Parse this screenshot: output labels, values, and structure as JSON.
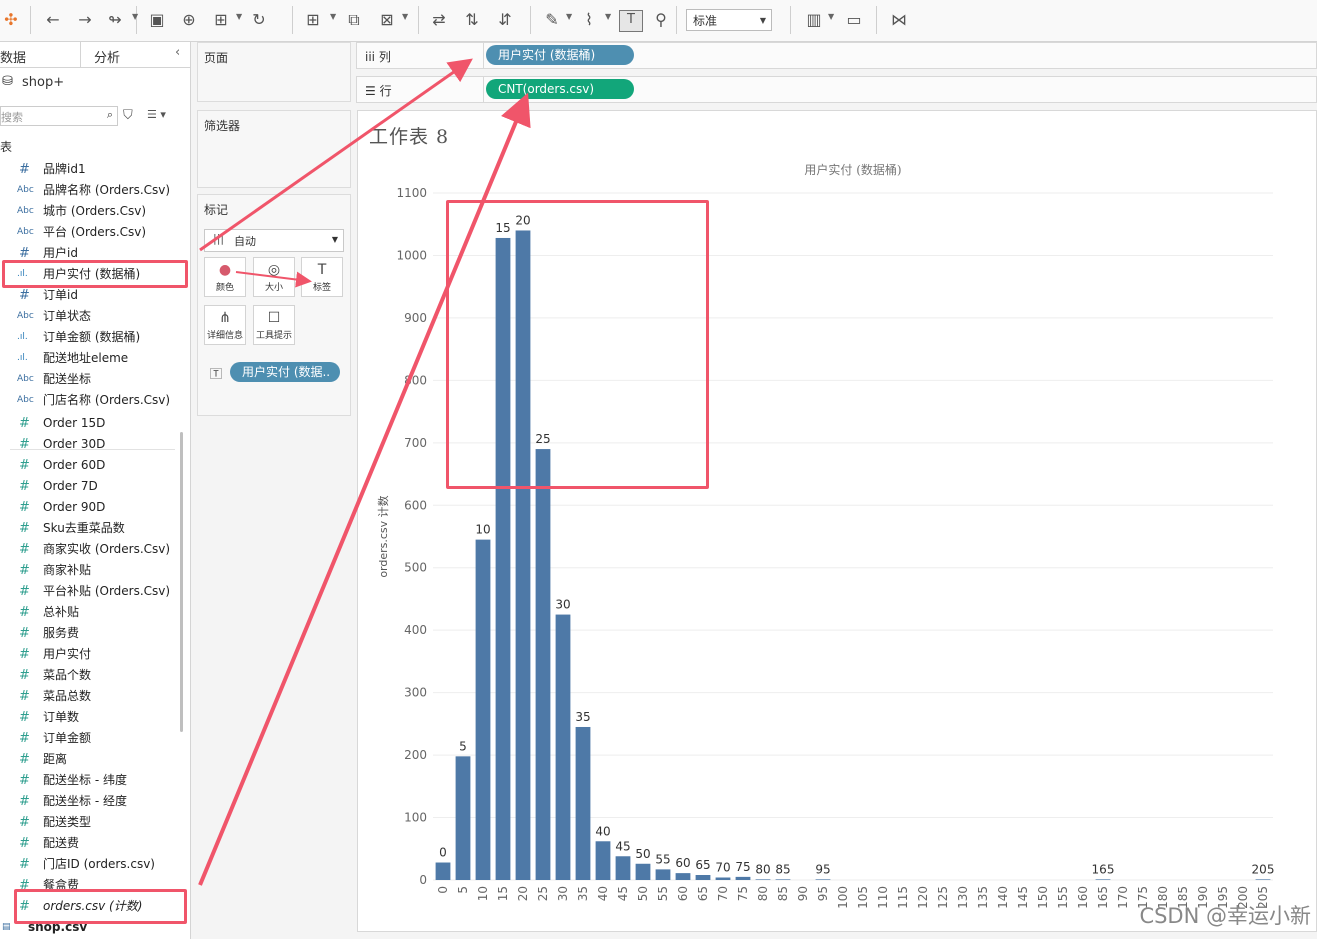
{
  "toolbar": {
    "icons": [
      "tableau-logo-icon",
      "undo-icon",
      "redo-icon",
      "replay-icon",
      "save-icon",
      "new-datasource-icon",
      "paste-datasource-icon",
      "refresh-icon",
      "new-sheet-icon",
      "duplicate-sheet-icon",
      "clear-sheet-icon",
      "swap-axes-icon",
      "sort-asc-icon",
      "sort-desc-icon",
      "highlight-icon",
      "group-icon",
      "show-labels-icon",
      "pin-icon",
      "show-me-icon",
      "presentation-icon",
      "share-icon"
    ],
    "view_size": "标准"
  },
  "data_pane": {
    "tab_data": "数据",
    "tab_analysis": "分析",
    "datasource": "shop+",
    "search_placeholder": "搜索",
    "table_header": "表",
    "fields": [
      {
        "type": "hash",
        "label": "品牌id1"
      },
      {
        "type": "abc",
        "label": "品牌名称 (Orders.Csv)"
      },
      {
        "type": "abc",
        "label": "城市 (Orders.Csv)"
      },
      {
        "type": "abc",
        "label": "平台 (Orders.Csv)"
      },
      {
        "type": "hash",
        "label": "用户id"
      },
      {
        "type": "bin",
        "label": "用户实付 (数据桶)"
      },
      {
        "type": "hash",
        "label": "订单id"
      },
      {
        "type": "abc",
        "label": "订单状态"
      },
      {
        "type": "bin",
        "label": "订单金额 (数据桶)"
      },
      {
        "type": "bin",
        "label": "配送地址eleme"
      },
      {
        "type": "abc",
        "label": "配送坐标"
      },
      {
        "type": "abc",
        "label": "门店名称 (Orders.Csv)"
      },
      {
        "type": "measure",
        "label": "Order 15D"
      },
      {
        "type": "measure",
        "label": "Order 30D"
      },
      {
        "type": "measure",
        "label": "Order 60D"
      },
      {
        "type": "measure",
        "label": "Order 7D"
      },
      {
        "type": "measure",
        "label": "Order 90D"
      },
      {
        "type": "measure",
        "label": "Sku去重菜品数"
      },
      {
        "type": "measure",
        "label": "商家实收 (Orders.Csv)"
      },
      {
        "type": "measure",
        "label": "商家补贴"
      },
      {
        "type": "measure",
        "label": "平台补贴 (Orders.Csv)"
      },
      {
        "type": "measure",
        "label": "总补贴"
      },
      {
        "type": "measure",
        "label": "服务费"
      },
      {
        "type": "measure",
        "label": "用户实付"
      },
      {
        "type": "measure",
        "label": "菜品个数"
      },
      {
        "type": "measure",
        "label": "菜品总数"
      },
      {
        "type": "measure",
        "label": "订单数"
      },
      {
        "type": "measure",
        "label": "订单金额"
      },
      {
        "type": "measure",
        "label": "距离"
      },
      {
        "type": "measure",
        "label": "配送坐标 - 纬度"
      },
      {
        "type": "measure",
        "label": "配送坐标 - 经度"
      },
      {
        "type": "measure",
        "label": "配送类型"
      },
      {
        "type": "measure",
        "label": "配送费"
      },
      {
        "type": "measure",
        "label": "门店ID (orders.csv)"
      },
      {
        "type": "measure",
        "label": "餐盒费"
      },
      {
        "type": "measure",
        "label": "orders.csv (计数)"
      },
      {
        "type": "table",
        "label": "shop.csv"
      }
    ]
  },
  "cards": {
    "pages": "页面",
    "filters": "筛选器",
    "marks": "标记",
    "mark_type": "自动",
    "mark_buttons": [
      {
        "icon": "color-icon",
        "label": "颜色"
      },
      {
        "icon": "size-icon",
        "label": "大小"
      },
      {
        "icon": "label-icon",
        "label": "标签"
      },
      {
        "icon": "detail-icon",
        "label": "详细信息"
      },
      {
        "icon": "tooltip-icon",
        "label": "工具提示"
      }
    ],
    "label_pill": "用户实付 (数据.."
  },
  "shelves": {
    "columns_label": "列",
    "columns_pill": "用户实付 (数据桶)",
    "rows_label": "行",
    "rows_pill": "CNT(orders.csv)"
  },
  "sheet": {
    "title": "工作表 8"
  },
  "colors": {
    "bar": "#4e79a7",
    "annotation": "#f0556a",
    "pill_blue": "#4e8fb1",
    "pill_green": "#12a67a"
  },
  "chart_data": {
    "type": "bar",
    "title": "用户实付 (数据桶)",
    "xlabel": "",
    "ylabel": "orders.csv 计数",
    "ylim": [
      0,
      1100
    ],
    "yticks": [
      0,
      100,
      200,
      300,
      400,
      500,
      600,
      700,
      800,
      900,
      1000,
      1100
    ],
    "grid": true,
    "categories": [
      "0",
      "5",
      "10",
      "15",
      "20",
      "25",
      "30",
      "35",
      "40",
      "45",
      "50",
      "55",
      "60",
      "65",
      "70",
      "75",
      "80",
      "85",
      "90",
      "95",
      "100",
      "105",
      "110",
      "115",
      "120",
      "125",
      "130",
      "135",
      "140",
      "145",
      "150",
      "155",
      "160",
      "165",
      "170",
      "175",
      "180",
      "185",
      "190",
      "195",
      "200",
      "205"
    ],
    "values": [
      28,
      198,
      545,
      1028,
      1040,
      690,
      425,
      245,
      62,
      38,
      26,
      17,
      11,
      8,
      4,
      5,
      1,
      1,
      0,
      1,
      0,
      0,
      0,
      0,
      0,
      0,
      0,
      0,
      0,
      0,
      0,
      0,
      0,
      1,
      0,
      0,
      0,
      0,
      0,
      0,
      0,
      1
    ],
    "data_labels": [
      "0",
      "5",
      "10",
      "15",
      "20",
      "25",
      "30",
      "35",
      "40",
      "45",
      "50",
      "55",
      "60",
      "65",
      "70",
      "75",
      "80",
      "85",
      "",
      "95",
      "",
      "",
      "",
      "",
      "",
      "",
      "",
      "",
      "",
      "",
      "",
      "",
      "",
      "165",
      "",
      "",
      "",
      "",
      "",
      "",
      "",
      "205"
    ]
  },
  "watermark": "CSDN @幸运小新"
}
